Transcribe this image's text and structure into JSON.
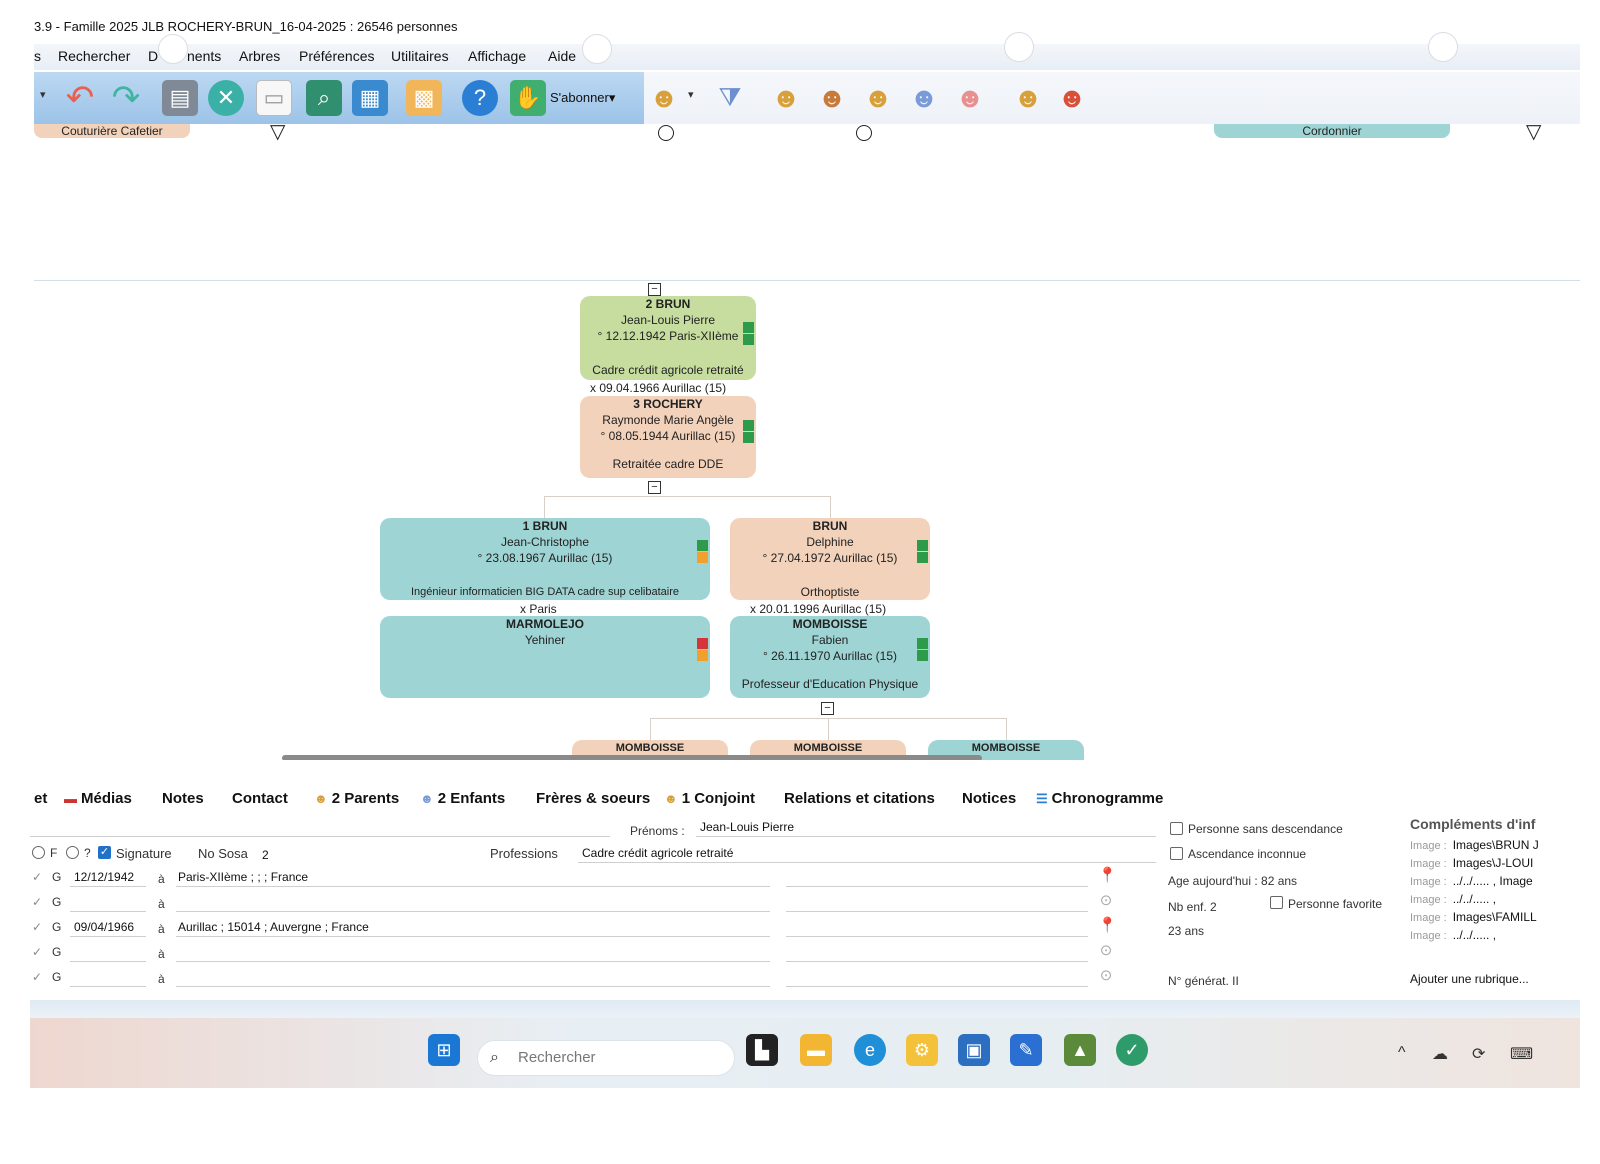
{
  "window": {
    "title": "3.9 - Famille 2025 JLB ROCHERY-BRUN_16-04-2025 : 26546 personnes"
  },
  "menu": {
    "items": [
      "s",
      "Rechercher",
      "D",
      "nents",
      "Arbres",
      "Préférences",
      "Utilitaires",
      "Affichage",
      "Aide"
    ]
  },
  "toolbar": {
    "subscribe_label": "S'abonner▾",
    "icons": [
      "back-arrow-icon",
      "forward-arrow-icon",
      "printer-icon",
      "tools-icon",
      "notepad-icon",
      "map-search-icon",
      "grid-icon",
      "mosaic-icon",
      "help-icon",
      "subscribe-icon",
      "person-search-icon",
      "filter-icon",
      "father-icon",
      "mother-icon",
      "parents-icon",
      "add-person-icon",
      "couple-icon",
      "add-child-icon",
      "delete-person-icon"
    ]
  },
  "top_tags": {
    "left": "Couturière Cafetier",
    "right": "Cordonnier"
  },
  "tree": {
    "father": {
      "head": "2 BRUN",
      "given": "Jean-Louis Pierre",
      "birth": "° 12.12.1942 Paris-XIIème",
      "profession": "Cadre crédit agricole retraité"
    },
    "parents_marriage": "x 09.04.1966 Aurillac (15)",
    "mother": {
      "head": "3 ROCHERY",
      "given": "Raymonde Marie Angèle",
      "birth": "° 08.05.1944 Aurillac (15)",
      "profession": "Retraitée cadre DDE"
    },
    "child1": {
      "head": "1 BRUN",
      "given": "Jean-Christophe",
      "birth": "° 23.08.1967 Aurillac (15)",
      "profession": "Ingénieur informaticien BIG DATA cadre sup celibataire"
    },
    "child1_marriage": "x Paris",
    "child1_spouse": {
      "head": "MARMOLEJO",
      "given": "Yehiner"
    },
    "child2": {
      "head": "BRUN",
      "given": "Delphine",
      "birth": "° 27.04.1972 Aurillac (15)",
      "profession": "Orthoptiste"
    },
    "child2_marriage": "x 20.01.1996 Aurillac (15)",
    "child2_spouse": {
      "head": "MOMBOISSE",
      "given": "Fabien",
      "birth": "° 26.11.1970 Aurillac (15)",
      "profession": "Professeur d'Education Physique"
    },
    "grandchildren": [
      "MOMBOISSE",
      "MOMBOISSE",
      "MOMBOISSE"
    ],
    "collapse_symbol": "−"
  },
  "tabs": [
    {
      "label": "et",
      "icon": ""
    },
    {
      "label": "Médias",
      "icon": "media-icon"
    },
    {
      "label": "Notes",
      "icon": ""
    },
    {
      "label": "Contact",
      "icon": ""
    },
    {
      "label": "2 Parents",
      "icon": "parents-icon"
    },
    {
      "label": "2 Enfants",
      "icon": "child-icon"
    },
    {
      "label": "Frères & soeurs",
      "icon": ""
    },
    {
      "label": "1 Conjoint",
      "icon": "spouse-icon"
    },
    {
      "label": "Relations et citations",
      "icon": ""
    },
    {
      "label": "Notices",
      "icon": ""
    },
    {
      "label": "Chronogramme",
      "icon": "timeline-icon"
    }
  ],
  "form": {
    "prenoms_label": "Prénoms :",
    "prenoms_value": "Jean-Louis Pierre",
    "sex_f": "F",
    "sex_unknown": "?",
    "signature_label": "Signature",
    "sosa_label": "No Sosa",
    "sosa_value": "2",
    "professions_label": "Professions",
    "professions_value": "Cadre crédit agricole retraité",
    "events": [
      {
        "cal": "G",
        "date": "12/12/1942",
        "a": "à",
        "place": "Paris-XIIème ; ; ; France",
        "pin": "red"
      },
      {
        "cal": "G",
        "date": "",
        "a": "à",
        "place": "",
        "pin": "grey"
      },
      {
        "cal": "G",
        "date": "09/04/1966",
        "a": "à",
        "place": "Aurillac ; 15014 ; Auvergne ; France",
        "pin": "red"
      },
      {
        "cal": "G",
        "date": "",
        "a": "à",
        "place": "",
        "pin": "grey"
      },
      {
        "cal": "G",
        "date": "",
        "a": "à",
        "place": "",
        "pin": "grey"
      }
    ],
    "sans_descendance": "Personne sans descendance",
    "ascendance_inconnue": "Ascendance inconnue",
    "age_today": "Age aujourd'hui : 82 ans",
    "nb_enf": "Nb enf. 2",
    "favorite": "Personne favorite",
    "age_marriage": "23 ans",
    "generation": "N° générat. II"
  },
  "complements": {
    "title": "Compléments d'inf",
    "images": [
      {
        "label": "Image :",
        "value": "Images\\BRUN J"
      },
      {
        "label": "Image :",
        "value": "Images\\J-LOUI"
      },
      {
        "label": "Image :",
        "value": "../../..... , Image"
      },
      {
        "label": "Image :",
        "value": "../../..... ,"
      },
      {
        "label": "Image :",
        "value": "Images\\FAMILL"
      },
      {
        "label": "Image :",
        "value": "../../..... ,"
      }
    ],
    "add_label": "Ajouter une rubrique..."
  },
  "taskbar": {
    "search_placeholder": "Rechercher",
    "apps": [
      "windows-start-icon",
      "file-explorer-dark-icon",
      "folder-icon",
      "edge-icon",
      "settings-app-icon",
      "store-icon",
      "editor-icon",
      "landscape-app-icon",
      "security-shield-icon"
    ],
    "tray": [
      "chevron-up-icon",
      "cloud-info-icon",
      "sync-icon",
      "keyboard-icon"
    ]
  },
  "colors": {
    "father_card": "#c6dd9f",
    "female_card": "#f2d2bb",
    "child_card": "#9fd4d4",
    "marker_green": "#2e9b4a",
    "marker_orange": "#f1a02c",
    "marker_red": "#d7333a"
  }
}
